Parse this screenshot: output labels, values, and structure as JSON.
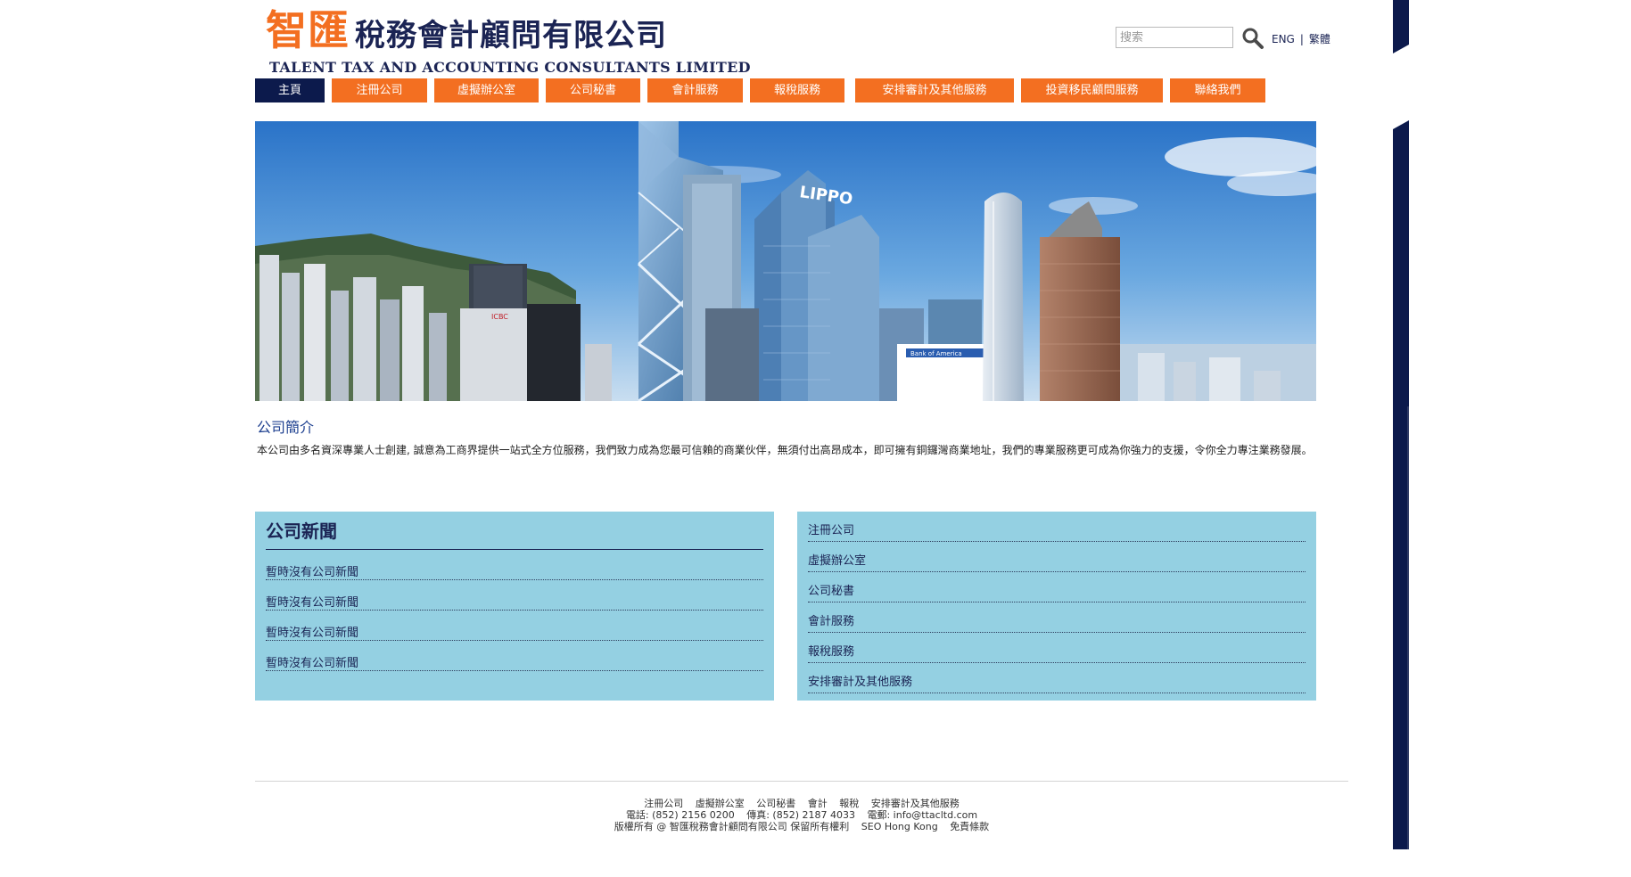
{
  "header": {
    "logo_cn_orange": "智匯",
    "logo_cn_blue": "稅務會計顧問有限公司",
    "logo_en": "TALENT TAX AND ACCOUNTING CONSULTANTS LIMITED",
    "search_placeholder": "搜索",
    "lang_en": "ENG",
    "lang_tc": "繁體"
  },
  "nav": {
    "items": [
      {
        "label": "主頁",
        "active": true
      },
      {
        "label": "注冊公司"
      },
      {
        "label": "虛擬辦公室"
      },
      {
        "label": "公司秘書"
      },
      {
        "label": "會計服務"
      },
      {
        "label": "報稅服務"
      },
      {
        "label": "安排審計及其他服務"
      },
      {
        "label": "投資移民顧問服務"
      },
      {
        "label": "聯絡我們"
      }
    ]
  },
  "banner": {
    "sign_lippo": "LIPPO",
    "sign_bank": "Bank of America",
    "sign_icbc": "ICBC"
  },
  "intro": {
    "title": "公司簡介",
    "text": "本公司由多名資深專業人士創建, 誠意為工商界提供一站式全方位服務，我們致力成為您最可信賴的商業伙伴，無須付出高昂成本，即可擁有銅鑼灣商業地址，我們的專業服務更可成為你強力的支援，令你全力專注業務發展。"
  },
  "news": {
    "title": "公司新聞",
    "items": [
      "暫時沒有公司新聞",
      "暫時沒有公司新聞",
      "暫時沒有公司新聞",
      "暫時沒有公司新聞"
    ]
  },
  "services": {
    "items": [
      "注冊公司",
      "虛擬辦公室",
      "公司秘書",
      "會計服務",
      "報稅服務",
      "安排審計及其他服務"
    ]
  },
  "footer": {
    "links": [
      "注冊公司",
      "虛擬辦公室",
      "公司秘書",
      "會計",
      "報稅",
      "安排審計及其他服務"
    ],
    "phone": "電話: (852) 2156 0200",
    "fax": "傳真: (852) 2187 4033",
    "email": "電郵: info@ttacltd.com",
    "copyright": "版權所有 @  智匯稅務會計顧問有限公司   保留所有權利",
    "seo": "SEO Hong Kong",
    "terms": "免責條款"
  },
  "colors": {
    "accent_orange": "#f36f21",
    "navy": "#0c1a4c",
    "panel_blue": "#94d0e2"
  }
}
